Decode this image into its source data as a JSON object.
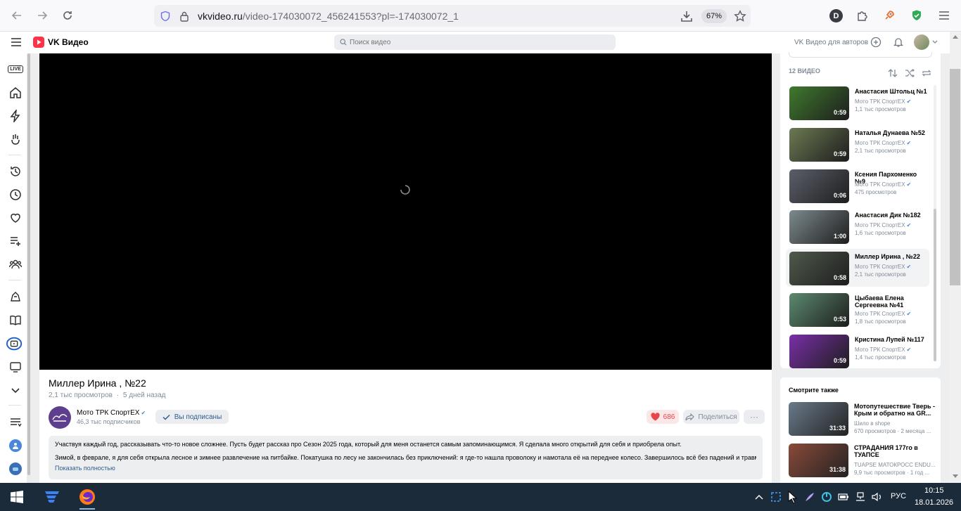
{
  "browser": {
    "url_domain": "vkvideo.ru",
    "url_path": "/video-174030072_456241553?pl=-174030072_1",
    "zoom": "67%",
    "profile_initial": "D"
  },
  "header": {
    "logo_text": "VK Видео",
    "search_placeholder": "Поиск видео",
    "authors_link": "VK Видео для авторов"
  },
  "nav": {
    "icons": [
      "live-icon",
      "home-icon",
      "shorts-icon",
      "discover-icon",
      "history-icon",
      "watch-later-icon",
      "likes-icon",
      "playlists-icon",
      "subscriptions-icon",
      "kids-icon",
      "catalog-icon",
      "channels-icon",
      "tv-icon",
      "expand-icon",
      "sort-icon",
      "profile-icon",
      "community-icon"
    ],
    "live_label": "LIVE"
  },
  "video": {
    "title": "Миллер Ирина , №22",
    "views": "2,1 тыс просмотров",
    "separator": "·",
    "date": "5 дней назад",
    "channel_name": "Мото ТРК СпортЕХ",
    "channel_subs": "46,3 тыс подписчиков",
    "subscribe_label": "Вы подписаны",
    "likes": "686",
    "share_label": "Поделиться",
    "more_label": "···",
    "description_1": "Участвуя каждый год, рассказывать что-то новое сложнее. Пусть будет рассказ про Сезон 2025 года, который для меня останется самым запоминающимся. Я сделала много открытий для себя и приобрела опыт.",
    "description_2": "Зимой, в феврале, я для себя открыла лесное и зимнее развлечение на питбайке. Покатушка по лесу не закончилась без приключений: я где-то нашла проволоку и намотала её на переднее колесо. Завершилось всё без падений и травм....",
    "show_more": "Показать полностью"
  },
  "playlist": {
    "count_label": "12 ВИДЕО",
    "items": [
      {
        "title": "Анастасия Штольц №1",
        "channel": "Мото ТРК СпортЕХ",
        "views": "1,1 тыс просмотров",
        "duration": "0:59",
        "color": "#3f7a2e"
      },
      {
        "title": "Наталья Дунаева №52",
        "channel": "Мото ТРК СпортЕХ",
        "views": "2,1 тыс просмотров",
        "duration": "0:59",
        "color": "#6c7a52"
      },
      {
        "title": "Ксения Пархоменко №9",
        "channel": "Мото ТРК СпортЕХ",
        "views": "475 просмотров",
        "duration": "0:06",
        "color": "#5b5f6a"
      },
      {
        "title": "Анастасия Дик №182",
        "channel": "Мото ТРК СпортЕХ",
        "views": "1,6 тыс просмотров",
        "duration": "1:00",
        "color": "#7d8a8e"
      },
      {
        "title": "Миллер Ирина , №22",
        "channel": "Мото ТРК СпортЕХ",
        "views": "2,1 тыс просмотров",
        "duration": "0:58",
        "color": "#4f5a4c"
      },
      {
        "title": "Цыбаева Елена Сергеевна №41",
        "channel": "Мото ТРК СпортЕХ",
        "views": "1,8 тыс просмотров",
        "duration": "0:53",
        "color": "#5c8a6f"
      },
      {
        "title": "Кристина Лупей №117",
        "channel": "Мото ТРК СпортЕХ",
        "views": "1,4 тыс просмотров",
        "duration": "0:59",
        "color": "#7a2fa8"
      }
    ]
  },
  "see_also": {
    "heading": "Смотрите также",
    "items": [
      {
        "title": "Мотопутешествие Тверь - Крым и обратно на GR...",
        "meta1": "Шило в shope",
        "meta2": "670 просмотров · 2 месяца ...",
        "duration": "31:33",
        "color": "#6a7a8a"
      },
      {
        "title": "СТРАДАНИЯ 177го в ТУАПСЕ",
        "meta1": "TUAPSE МАТОКРОСС ENDU...",
        "meta2": "9,9 тыс просмотров · 1 год ...",
        "duration": "31:38",
        "color": "#8a4a3a"
      }
    ]
  },
  "taskbar": {
    "lang": "РУС",
    "time": "10:15",
    "date": "18.01.2026"
  },
  "colors": {
    "vk_red": "#ff3347",
    "accent_blue": "#2d5d90",
    "like_red": "#e64646",
    "taskbar": "#1c2b3a"
  }
}
